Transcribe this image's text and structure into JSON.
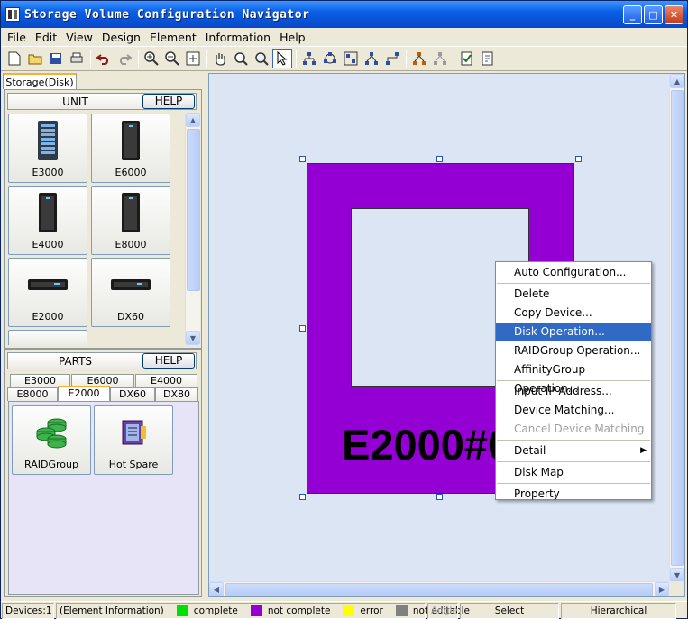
{
  "window": {
    "title": "Storage Volume Configuration Navigator"
  },
  "menu": [
    "File",
    "Edit",
    "View",
    "Design",
    "Element",
    "Information",
    "Help"
  ],
  "left_tab": "Storage(Disk)",
  "unit_section": {
    "title": "UNIT",
    "help_label": "HELP",
    "tiles": [
      {
        "label": "E3000",
        "icon": "rack-storage-icon"
      },
      {
        "label": "E6000",
        "icon": "tower-storage-icon"
      },
      {
        "label": "E4000",
        "icon": "tower-storage-icon"
      },
      {
        "label": "E8000",
        "icon": "tower-storage-icon"
      },
      {
        "label": "E2000",
        "icon": "enclosure-storage-icon"
      },
      {
        "label": "DX60",
        "icon": "enclosure-storage-icon"
      }
    ]
  },
  "parts_section": {
    "title": "PARTS",
    "help_label": "HELP",
    "tabs_row1": [
      "E3000",
      "E6000",
      "E4000"
    ],
    "tabs_row2": [
      "E8000",
      "E2000",
      "DX60",
      "DX80"
    ],
    "active_tab": "E2000",
    "items": [
      {
        "label": "RAIDGroup",
        "icon": "disk-stack-icon"
      },
      {
        "label": "Hot Spare",
        "icon": "hot-spare-disk-icon"
      }
    ]
  },
  "canvas": {
    "device_label": "E2000#0",
    "device_color": "#9400d3",
    "background": "#dbe5f4"
  },
  "context_menu": {
    "items": [
      {
        "label": "Auto Configuration...",
        "state": "normal"
      },
      {
        "sep": true
      },
      {
        "label": "Delete",
        "state": "normal"
      },
      {
        "label": "Copy Device...",
        "state": "normal"
      },
      {
        "label": "Disk Operation...",
        "state": "highlighted"
      },
      {
        "label": "RAIDGroup Operation...",
        "state": "normal"
      },
      {
        "label": "AffinityGroup Operation...",
        "state": "normal"
      },
      {
        "sep": true
      },
      {
        "label": "Input IP Address...",
        "state": "normal"
      },
      {
        "label": "Device Matching...",
        "state": "normal"
      },
      {
        "label": "Cancel Device Matching",
        "state": "disabled"
      },
      {
        "sep": true
      },
      {
        "label": "Detail",
        "state": "submenu"
      },
      {
        "sep": true
      },
      {
        "label": "Disk Map",
        "state": "normal"
      },
      {
        "sep": true
      },
      {
        "label": "Property",
        "state": "normal"
      }
    ]
  },
  "status": {
    "devices": "Devices:1",
    "element_info": "(Element Information)",
    "legend": [
      {
        "label": "complete",
        "color": "#00e000"
      },
      {
        "label": "not complete",
        "color": "#9400d3"
      },
      {
        "label": "error",
        "color": "#ffff00"
      },
      {
        "label": "not editable",
        "color": "#808080"
      }
    ],
    "angle": "Angle",
    "mode": "Select",
    "layout": "Hierarchical"
  }
}
